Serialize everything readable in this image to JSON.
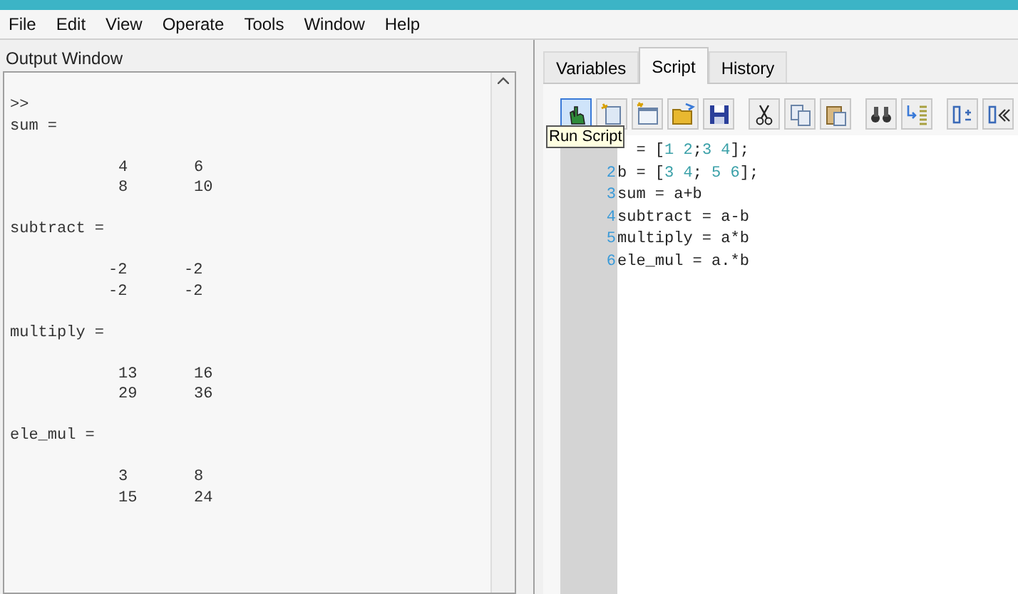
{
  "menu": [
    "File",
    "Edit",
    "View",
    "Operate",
    "Tools",
    "Window",
    "Help"
  ],
  "output_window": {
    "title": "Output Window",
    "blocks": [
      {
        "kind": "text",
        "text": ">>"
      },
      {
        "kind": "text",
        "text": "sum ="
      },
      {
        "kind": "matrix",
        "rows": [
          [
            "4",
            "6"
          ],
          [
            "8",
            "10"
          ]
        ]
      },
      {
        "kind": "text",
        "text": "subtract ="
      },
      {
        "kind": "matrix",
        "rows": [
          [
            "-2",
            "-2"
          ],
          [
            "-2",
            "-2"
          ]
        ]
      },
      {
        "kind": "text",
        "text": "multiply ="
      },
      {
        "kind": "matrix",
        "rows": [
          [
            "13",
            "16"
          ],
          [
            "29",
            "36"
          ]
        ]
      },
      {
        "kind": "text",
        "text": "ele_mul ="
      },
      {
        "kind": "matrix",
        "rows": [
          [
            "3",
            "8"
          ],
          [
            "15",
            "24"
          ]
        ]
      }
    ]
  },
  "tabs": [
    {
      "label": "Variables",
      "selected": false
    },
    {
      "label": "Script",
      "selected": true
    },
    {
      "label": "History",
      "selected": false
    }
  ],
  "toolbar": [
    {
      "kind": "run",
      "highlighted": true
    },
    {
      "kind": "new-script",
      "highlighted": false
    },
    {
      "kind": "new-window",
      "highlighted": false
    },
    {
      "kind": "open",
      "highlighted": false
    },
    {
      "kind": "save",
      "highlighted": false
    },
    {
      "kind": "cut",
      "highlighted": false
    },
    {
      "kind": "copy",
      "highlighted": false
    },
    {
      "kind": "paste",
      "highlighted": false
    },
    {
      "kind": "find",
      "highlighted": false
    },
    {
      "kind": "indent",
      "highlighted": false
    },
    {
      "kind": "comment",
      "highlighted": false
    },
    {
      "kind": "uncomment",
      "highlighted": false
    }
  ],
  "tooltip": "Run Script",
  "script_lines": [
    {
      "code": "= [1 2;3 4];"
    },
    {
      "number": "2",
      "code": "b = [3 4; 5 6];"
    },
    {
      "number": "3",
      "code": "sum = a+b"
    },
    {
      "number": "4",
      "code": "subtract = a-b"
    },
    {
      "number": "5",
      "code": "multiply = a*b"
    },
    {
      "number": "6",
      "code": "ele_mul = a.*b"
    }
  ]
}
